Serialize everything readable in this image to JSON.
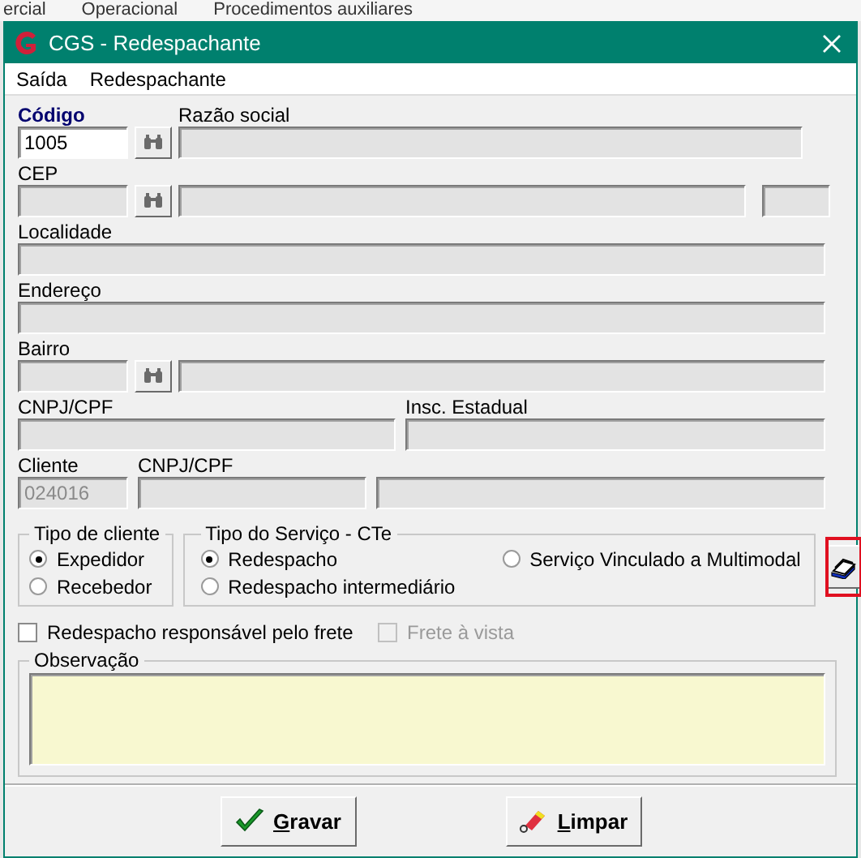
{
  "background_menu": [
    "ercial",
    "Operacional",
    "Procedimentos auxiliares"
  ],
  "window": {
    "title": "CGS - Redespachante"
  },
  "menu": [
    "Saída",
    "Redespachante"
  ],
  "codigo": {
    "label": "Código",
    "value": "1005",
    "disabled": false
  },
  "razao_social": {
    "label": "Razão social",
    "disabled": true
  },
  "cep": {
    "label": "CEP",
    "disabled": true
  },
  "localidade": {
    "label": "Localidade",
    "disabled": true
  },
  "endereco": {
    "label": "Endereço",
    "disabled": true
  },
  "bairro": {
    "label": "Bairro",
    "disabled": true
  },
  "cnpj_cpf": {
    "label": "CNPJ/CPF",
    "disabled": true
  },
  "insc_estadual": {
    "label": "Insc. Estadual",
    "disabled": true
  },
  "cliente": {
    "label": "Cliente",
    "value": "024016",
    "disabled": true
  },
  "cliente_cnpj_cpf": {
    "label": "CNPJ/CPF",
    "disabled": true
  },
  "client_type": {
    "title": "Tipo de cliente",
    "options": [
      {
        "label": "Expedidor",
        "selected": true
      },
      {
        "label": "Recebedor",
        "selected": false
      }
    ]
  },
  "service_type": {
    "title": "Tipo do Serviço - CTe",
    "options": [
      {
        "label": "Redespacho",
        "selected": true
      },
      {
        "label": "Serviço Vinculado a Multimodal",
        "selected": false
      },
      {
        "label": "Redespacho intermediário",
        "selected": false
      }
    ]
  },
  "checkboxes": [
    {
      "label": "Redespacho responsável pelo frete",
      "checked": false,
      "disabled": false
    },
    {
      "label": "Frete à vista",
      "checked": false,
      "disabled": true
    }
  ],
  "observacao": {
    "title": "Observação"
  },
  "buttons": [
    {
      "label": "Gravar",
      "kind": "save"
    },
    {
      "label": "Limpar",
      "kind": "clear"
    }
  ]
}
